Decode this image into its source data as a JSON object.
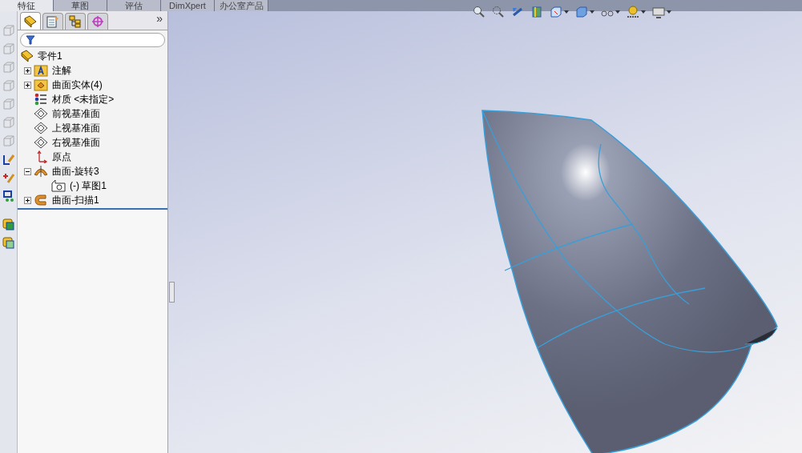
{
  "command_tabs": [
    {
      "label": "特征",
      "selected": true
    },
    {
      "label": "草图",
      "selected": false
    },
    {
      "label": "评估",
      "selected": false
    },
    {
      "label": "DimXpert",
      "selected": false
    },
    {
      "label": "办公室产品",
      "selected": false
    }
  ],
  "panel_tabs": [
    {
      "kind": "feature",
      "selected": true
    },
    {
      "kind": "property",
      "selected": false
    },
    {
      "kind": "config",
      "selected": false
    },
    {
      "kind": "display",
      "selected": false
    }
  ],
  "panel_more": "»",
  "tree": {
    "root": "零件1",
    "items": [
      {
        "label": "注解",
        "kind": "annotation",
        "expanded": false
      },
      {
        "label": "曲面实体(4)",
        "kind": "bodies",
        "expanded": false
      },
      {
        "label": "材质 <未指定>",
        "kind": "material"
      },
      {
        "label": "前视基准面",
        "kind": "plane"
      },
      {
        "label": "上视基准面",
        "kind": "plane"
      },
      {
        "label": "右视基准面",
        "kind": "plane"
      },
      {
        "label": "原点",
        "kind": "origin"
      },
      {
        "label": "曲面-旋转3",
        "kind": "revolve",
        "expanded": true,
        "children": [
          {
            "label": "(-) 草图1",
            "kind": "sketch"
          }
        ]
      },
      {
        "label": "曲面-扫描1",
        "kind": "sweep",
        "expanded": false
      }
    ]
  }
}
